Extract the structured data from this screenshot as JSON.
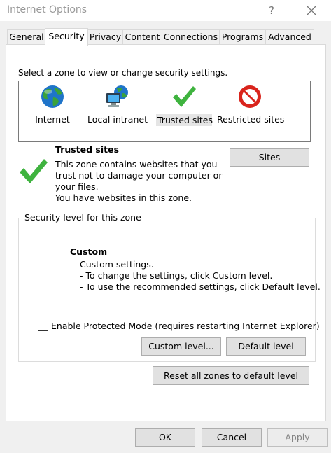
{
  "window": {
    "title": "Internet Options",
    "help_glyph": "?",
    "close_glyph": "✕"
  },
  "tabs": [
    {
      "label": "General",
      "active": false
    },
    {
      "label": "Security",
      "active": true
    },
    {
      "label": "Privacy",
      "active": false
    },
    {
      "label": "Content",
      "active": false
    },
    {
      "label": "Connections",
      "active": false
    },
    {
      "label": "Programs",
      "active": false
    },
    {
      "label": "Advanced",
      "active": false
    }
  ],
  "security": {
    "zone_prompt": "Select a zone to view or change security settings.",
    "zones": [
      {
        "label": "Internet",
        "icon": "globe-icon"
      },
      {
        "label": "Local intranet",
        "icon": "intranet-icon"
      },
      {
        "label": "Trusted sites",
        "icon": "checkmark-icon",
        "selected": true
      },
      {
        "label": "Restricted sites",
        "icon": "restricted-icon"
      }
    ],
    "selected_zone": {
      "name": "Trusted sites",
      "description": [
        "This zone contains websites that you",
        "trust not to damage your computer or",
        "your files.",
        "You have websites in this zone."
      ],
      "sites_button": "Sites"
    },
    "level_group": {
      "legend": "Security level for this zone",
      "level_name": "Custom",
      "level_description": [
        "Custom settings.",
        "- To change the settings, click Custom level.",
        "- To use the recommended settings, click Default level."
      ],
      "protected_mode_label": "Enable Protected Mode (requires restarting Internet Explorer)",
      "protected_mode_checked": false,
      "custom_level_button": "Custom level...",
      "default_level_button": "Default level"
    },
    "reset_button": "Reset all zones to default level"
  },
  "footer": {
    "ok": "OK",
    "cancel": "Cancel",
    "apply": "Apply",
    "apply_enabled": false
  },
  "colors": {
    "check_green": "#3fb33f",
    "restricted_red": "#d9241c",
    "globe_blue": "#1f74c9",
    "globe_green": "#3aa23a"
  }
}
